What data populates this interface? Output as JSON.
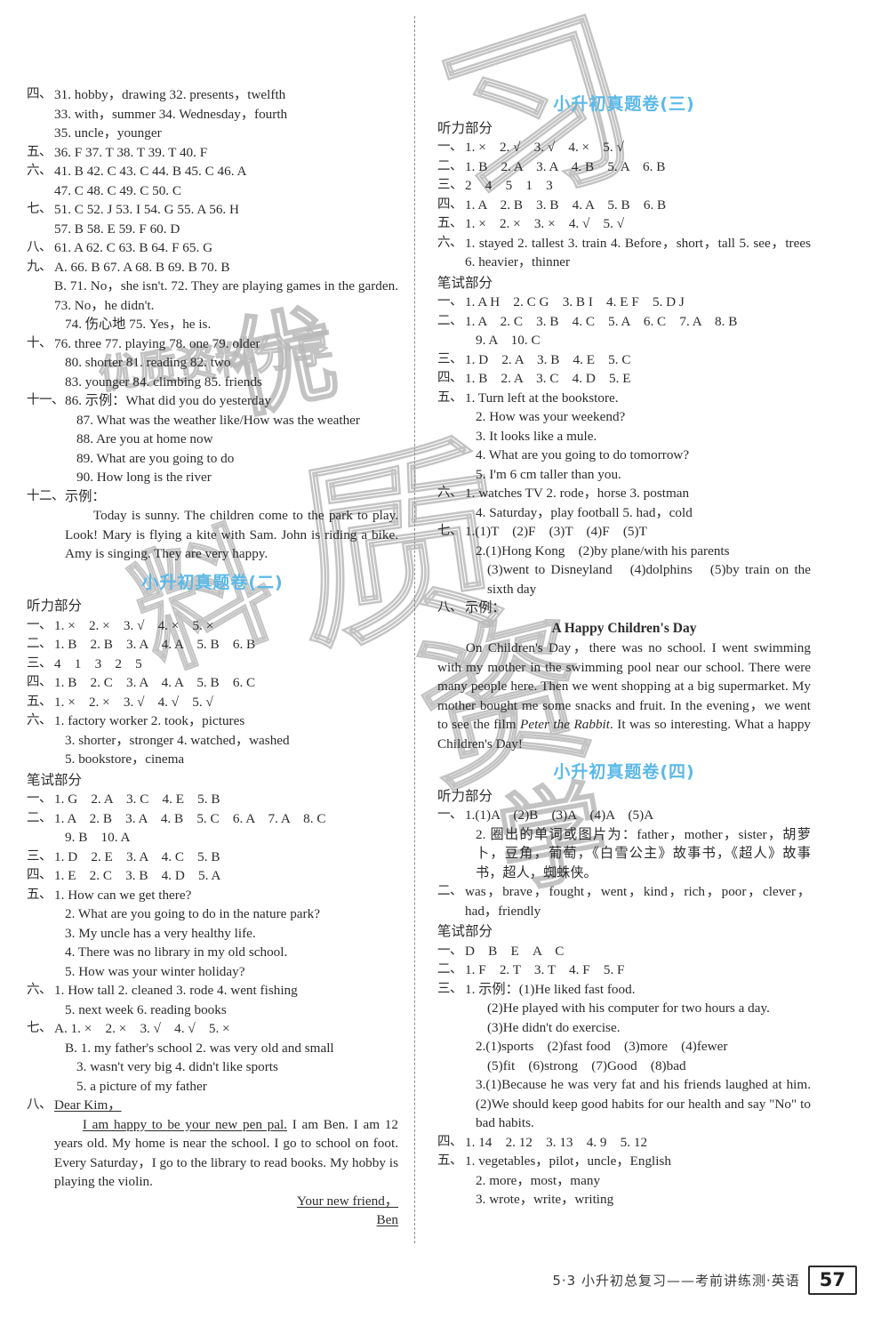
{
  "footer": {
    "text": "5·3 小升初总复习——考前讲练测·英语",
    "page_number": "57"
  },
  "watermark": {
    "glyphs": [
      "习",
      "优",
      "质",
      "资",
      "料",
      "学"
    ],
    "small_text": "优质资料分享"
  },
  "labels": {
    "listening_section": "听力部分",
    "written_section": "笔试部分",
    "example": "示例："
  },
  "left_column": {
    "continued_answers": [
      {
        "marker": "四、",
        "lines": [
          "31. hobby，drawing  32. presents，twelfth",
          "33. with，summer  34. Wednesday，fourth",
          "35. uncle，younger"
        ]
      },
      {
        "marker": "五、",
        "lines": [
          "36. F  37. T  38. T  39. T  40. F"
        ]
      },
      {
        "marker": "六、",
        "lines": [
          "41. B  42. C  43. C  44. B  45. C  46. A",
          "47. C  48. C  49. C  50. C"
        ]
      },
      {
        "marker": "七、",
        "lines": [
          "51. C  52. J  53. I  54. G  55. A  56. H",
          "57. B  58. E  59. F  60. D"
        ]
      },
      {
        "marker": "八、",
        "lines": [
          "61. A  62. C  63. B  64. F  65. G"
        ]
      },
      {
        "marker": "九、",
        "lines": [
          "A. 66. B  67. A  68. B  69. B  70. B",
          "B. 71. No，she isn't.  72. They are playing games in the garden.  73. No，he didn't.",
          "74. 伤心地  75. Yes，he is."
        ]
      },
      {
        "marker": "十、",
        "lines": [
          "76. three  77. playing  78. one  79. older",
          "80. shorter  81. reading  82. two",
          "83. younger  84. climbing  85. friends"
        ]
      },
      {
        "marker": "十一、",
        "lines": [
          "86. 示例：What did you do yesterday",
          "87. What was the weather like/How was the weather",
          "88. Are you at home now",
          "89. What are you going to do",
          "90. How long is the river"
        ]
      }
    ],
    "item12": {
      "marker": "十二、",
      "label": "示例：",
      "paragraph": "Today is sunny. The children come to the park to play. Look! Mary is flying a kite with Sam. John is riding a bike. Amy is singing. They are very happy."
    },
    "paper2": {
      "title": "小升初真题卷(二)",
      "listening": [
        {
          "marker": "一、",
          "lines": [
            "1. ×　2. ×　3. √　4. ×　5. ×"
          ]
        },
        {
          "marker": "二、",
          "lines": [
            "1. B　2. B　3. A　4. A　5. B　6. B"
          ]
        },
        {
          "marker": "三、",
          "lines": [
            "4　1　3　2　5"
          ]
        },
        {
          "marker": "四、",
          "lines": [
            "1. B　2. C　3. A　4. A　5. B　6. C"
          ]
        },
        {
          "marker": "五、",
          "lines": [
            "1. ×　2. ×　3. √　4. √　5. √"
          ]
        },
        {
          "marker": "六、",
          "lines": [
            "1. factory worker  2. took，pictures",
            "3. shorter，stronger  4. watched，washed",
            "5. bookstore，cinema"
          ]
        }
      ],
      "written": [
        {
          "marker": "一、",
          "lines": [
            "1. G　2. A　3. C　4. E　5. B"
          ]
        },
        {
          "marker": "二、",
          "lines": [
            "1. A　2. B　3. A　4. B　5. C　6. A　7. A　8. C",
            "9. B　10. A"
          ]
        },
        {
          "marker": "三、",
          "lines": [
            "1. D　2. E　3. A　4. C　5. B"
          ]
        },
        {
          "marker": "四、",
          "lines": [
            "1. E　2. C　3. B　4. D　5. A"
          ]
        },
        {
          "marker": "五、",
          "lines": [
            "1. How can we get there?",
            "2. What are you going to do in the nature park?",
            "3. My uncle has a very healthy life.",
            "4. There was no library in my old school.",
            "5. How was your winter holiday?"
          ]
        },
        {
          "marker": "六、",
          "lines": [
            "1. How tall  2. cleaned  3. rode  4. went fishing",
            "5. next week  6. reading books"
          ]
        },
        {
          "marker": "七、",
          "lines": [
            "A. 1. ×　2. ×　3. √　4. √　5. ×",
            "B. 1. my father's school  2. was very old and small",
            "3. wasn't very big  4. didn't like sports",
            "5. a picture of my father"
          ]
        }
      ],
      "letter": {
        "marker": "八、",
        "salutation": "Dear Kim，",
        "body_underlined": "I am happy to be your new pen pal.",
        "body_rest": " I am Ben. I am 12 years old. My home is near the school. I go to school on foot. Every Saturday，I go to the library to read books. My hobby is playing the violin.",
        "sign_line1": "Your new friend，",
        "sign_line2": "Ben"
      }
    }
  },
  "right_column": {
    "paper3": {
      "title": "小升初真题卷(三)",
      "listening": [
        {
          "marker": "一、",
          "lines": [
            "1. ×　2. √　3. √　4. ×　5. √"
          ]
        },
        {
          "marker": "二、",
          "lines": [
            "1. B　2. A　3. A　4. B　5. A　6. B"
          ]
        },
        {
          "marker": "三、",
          "lines": [
            "2　4　5　1　3"
          ]
        },
        {
          "marker": "四、",
          "lines": [
            "1. A　2. B　3. B　4. A　5. B　6. B"
          ]
        },
        {
          "marker": "五、",
          "lines": [
            "1. ×　2. ×　3. ×　4. √　5. √"
          ]
        },
        {
          "marker": "六、",
          "lines": [
            "1. stayed  2. tallest  3. train  4. Before，short，tall  5. see，trees  6. heavier，thinner"
          ]
        }
      ],
      "written": [
        {
          "marker": "一、",
          "lines": [
            "1. A H　2. C G　3. B I　4. E F　5. D J"
          ]
        },
        {
          "marker": "二、",
          "lines": [
            "1. A　2. C　3. B　4. C　5. A　6. C　7. A　8. B",
            "9. A　10. C"
          ]
        },
        {
          "marker": "三、",
          "lines": [
            "1. D　2. A　3. B　4. E　5. C"
          ]
        },
        {
          "marker": "四、",
          "lines": [
            "1. B　2. A　3. C　4. D　5. E"
          ]
        },
        {
          "marker": "五、",
          "lines": [
            "1. Turn left at the bookstore.",
            "2. How was your weekend?",
            "3. It looks like a mule.",
            "4. What are you going to do tomorrow?",
            "5. I'm 6 cm taller than you."
          ]
        },
        {
          "marker": "六、",
          "lines": [
            "1. watches TV  2. rode，horse  3. postman",
            "4. Saturday，play football  5. had，cold"
          ]
        },
        {
          "marker": "七、",
          "lines": [
            "1.(1)T　(2)F　(3)T　(4)F　(5)T",
            "2.(1)Hong Kong　(2)by plane/with his parents",
            "(3)went to Disneyland　(4)dolphins　(5)by train on the sixth day"
          ]
        }
      ],
      "essay": {
        "marker": "八、",
        "label": "示例：",
        "title": "A Happy Children's Day",
        "body_1": "On Children's Day，there was no school. I went swimming with my mother in the swimming pool near our school. There were many people here. Then we went shopping at a big supermarket. My mother bought me some snacks and fruit. In the evening，we went to see the film ",
        "film_title": "Peter the Rabbit",
        "body_2": ". It was so interesting. What a happy Children's Day!"
      }
    },
    "paper4": {
      "title": "小升初真题卷(四)",
      "listening": [
        {
          "marker": "一、",
          "lines": [
            "1.(1)A　(2)B　(3)A　(4)A　(5)A",
            "2. 圈出的单词或图片为：father，mother，sister，胡萝卜，豆角，葡萄，《白雪公主》故事书，《超人》故事书，超人，蜘蛛侠。"
          ]
        },
        {
          "marker": "二、",
          "lines": [
            "was，brave，fought，went，kind，rich，poor，clever，had，friendly"
          ]
        }
      ],
      "written": [
        {
          "marker": "一、",
          "lines": [
            "D　B　E　A　C"
          ]
        },
        {
          "marker": "二、",
          "lines": [
            "1. F　2. T　3. T　4. F　5. F"
          ]
        },
        {
          "marker": "三、",
          "lines": [
            "1. 示例：(1)He liked fast food.",
            "(2)He played with his computer for two hours a day.",
            "(3)He didn't do exercise.",
            "2.(1)sports　(2)fast food　(3)more　(4)fewer",
            "(5)fit　(6)strong　(7)Good　(8)bad",
            "3.(1)Because he was very fat and his friends laughed at him.　(2)We should keep good habits for our health and say \"No\" to bad habits."
          ]
        },
        {
          "marker": "四、",
          "lines": [
            "1. 14　2. 12　3. 13　4. 9　5. 12"
          ]
        },
        {
          "marker": "五、",
          "lines": [
            "1. vegetables，pilot，uncle，English",
            "2. more，most，many",
            "3. wrote，write，writing"
          ]
        }
      ]
    }
  }
}
